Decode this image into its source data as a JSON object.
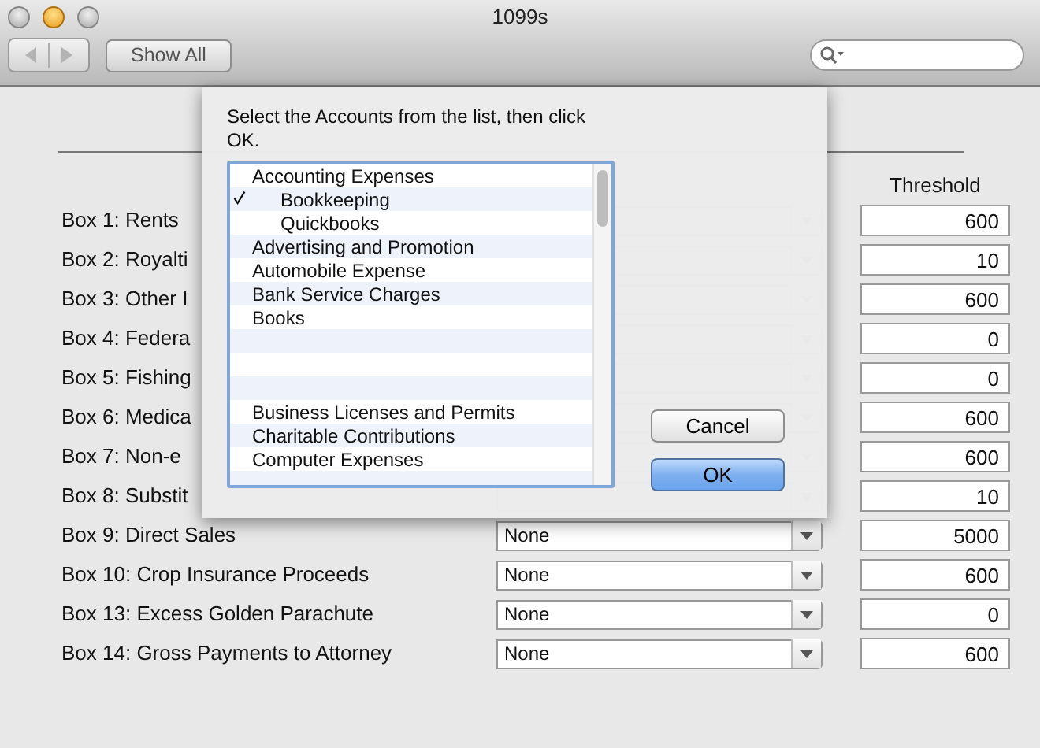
{
  "window": {
    "title": "1099s",
    "show_all": "Show All"
  },
  "table": {
    "threshold_header": "Threshold",
    "rows": [
      {
        "label": "Box 1:  Rents",
        "threshold": "600"
      },
      {
        "label": "Box 2:  Royalti",
        "threshold": "10"
      },
      {
        "label": "Box 3:  Other I",
        "threshold": "600"
      },
      {
        "label": "Box 4:  Federa",
        "threshold": "0"
      },
      {
        "label": "Box 5:  Fishing",
        "threshold": "0"
      },
      {
        "label": "Box 6:  Medica",
        "threshold": "600"
      },
      {
        "label": "Box 7:  Non-e",
        "threshold": "600"
      },
      {
        "label": "Box 8:  Substit",
        "threshold": "10"
      },
      {
        "label": "Box 9:  Direct Sales",
        "account": "None",
        "threshold": "5000"
      },
      {
        "label": "Box 10:  Crop Insurance Proceeds",
        "account": "None",
        "threshold": "600"
      },
      {
        "label": "Box 13:  Excess Golden Parachute",
        "account": "None",
        "threshold": "0"
      },
      {
        "label": "Box 14:  Gross Payments to Attorney",
        "account": "None",
        "threshold": "600"
      }
    ]
  },
  "sheet": {
    "message": "Select the Accounts from the list, then click OK.",
    "items": [
      {
        "kind": "account",
        "text": "Accounting Expenses",
        "checked": false,
        "children": [
          {
            "kind": "account",
            "text": "Bookkeeping",
            "checked": true
          },
          {
            "kind": "account",
            "text": "Quickbooks",
            "checked": false
          }
        ]
      },
      {
        "kind": "account",
        "text": "Advertising and Promotion",
        "checked": false
      },
      {
        "kind": "account",
        "text": "Automobile Expense",
        "checked": false
      },
      {
        "kind": "account",
        "text": "Bank Service Charges",
        "checked": false
      },
      {
        "kind": "account",
        "text": "Books",
        "checked": false
      },
      {
        "kind": "blank"
      },
      {
        "kind": "blank"
      },
      {
        "kind": "blank"
      },
      {
        "kind": "account",
        "text": "Business Licenses and Permits",
        "checked": false
      },
      {
        "kind": "account",
        "text": "Charitable Contributions",
        "checked": false
      },
      {
        "kind": "account",
        "text": "Computer Expenses",
        "checked": false
      }
    ],
    "buttons": [
      {
        "label": "Cancel",
        "default": false
      },
      {
        "label": "OK",
        "default": true
      }
    ]
  }
}
